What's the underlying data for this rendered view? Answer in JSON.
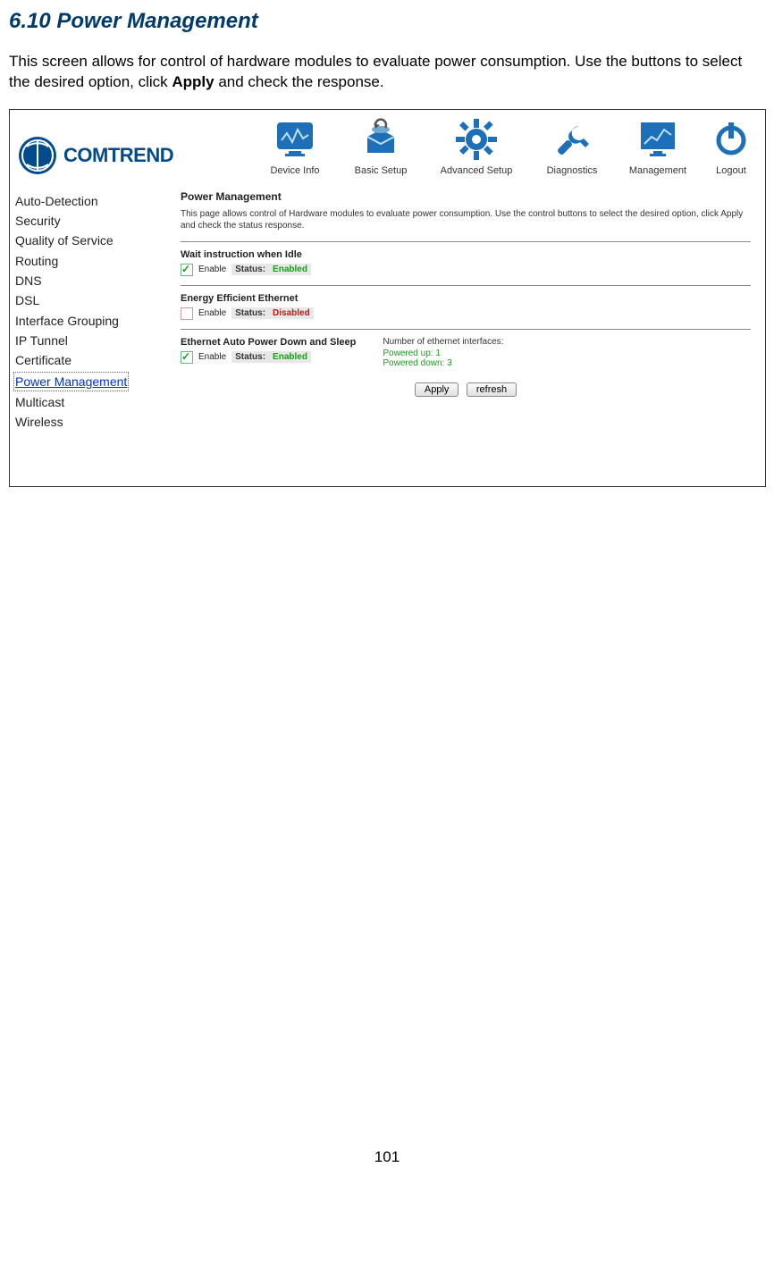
{
  "doc": {
    "heading": "6.10 Power Management",
    "intro_before_bold": "This screen allows for control of hardware modules to evaluate power consumption. Use the buttons to select the desired option, click ",
    "intro_bold": "Apply",
    "intro_after_bold": " and check the response.",
    "page_number": "101"
  },
  "brand": {
    "name": "COMTREND"
  },
  "nav": {
    "items": [
      "Device Info",
      "Basic Setup",
      "Advanced Setup",
      "Diagnostics",
      "Management",
      "Logout"
    ]
  },
  "sidebar": {
    "items": [
      "Auto-Detection",
      "Security",
      "Quality of Service",
      "Routing",
      "DNS",
      "DSL",
      "Interface Grouping",
      "IP Tunnel",
      "Certificate",
      "Power Management",
      "Multicast",
      "Wireless"
    ],
    "active_index": 9
  },
  "content": {
    "title": "Power Management",
    "description": "This page allows control of Hardware modules to evaluate power consumption. Use the control buttons to select the desired option, click Apply and check the status response.",
    "sections": {
      "idle": {
        "title": "Wait instruction when Idle",
        "enable_label": "Enable",
        "checked": true,
        "status_label": "Status:",
        "status_value": "Enabled"
      },
      "eee": {
        "title": "Energy Efficient Ethernet",
        "enable_label": "Enable",
        "checked": false,
        "status_label": "Status:",
        "status_value": "Disabled"
      },
      "autopd": {
        "title": "Ethernet Auto Power Down and Sleep",
        "enable_label": "Enable",
        "checked": true,
        "status_label": "Status:",
        "status_value": "Enabled",
        "iface_title": "Number of ethernet interfaces:",
        "iface_up": "Powered up: 1",
        "iface_down": "Powered down: 3"
      }
    },
    "buttons": {
      "apply": "Apply",
      "refresh": "refresh"
    }
  }
}
